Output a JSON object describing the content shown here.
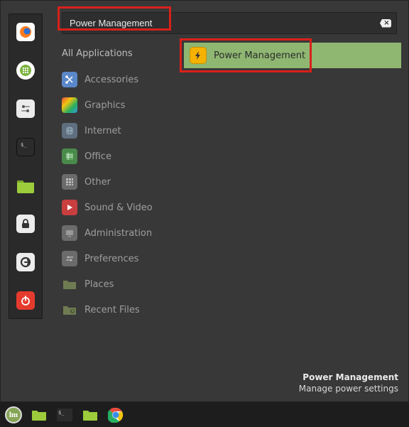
{
  "search": {
    "value": "Power Management"
  },
  "categories": {
    "all": "All Applications",
    "items": [
      {
        "label": "Accessories"
      },
      {
        "label": "Graphics"
      },
      {
        "label": "Internet"
      },
      {
        "label": "Office"
      },
      {
        "label": "Other"
      },
      {
        "label": "Sound & Video"
      },
      {
        "label": "Administration"
      },
      {
        "label": "Preferences"
      },
      {
        "label": "Places"
      },
      {
        "label": "Recent Files"
      }
    ]
  },
  "results": {
    "selected": {
      "label": "Power Management"
    }
  },
  "footer": {
    "title": "Power Management",
    "desc": "Manage power settings"
  },
  "colors": {
    "accent": "#8fb772",
    "hl": "#d8201a"
  }
}
